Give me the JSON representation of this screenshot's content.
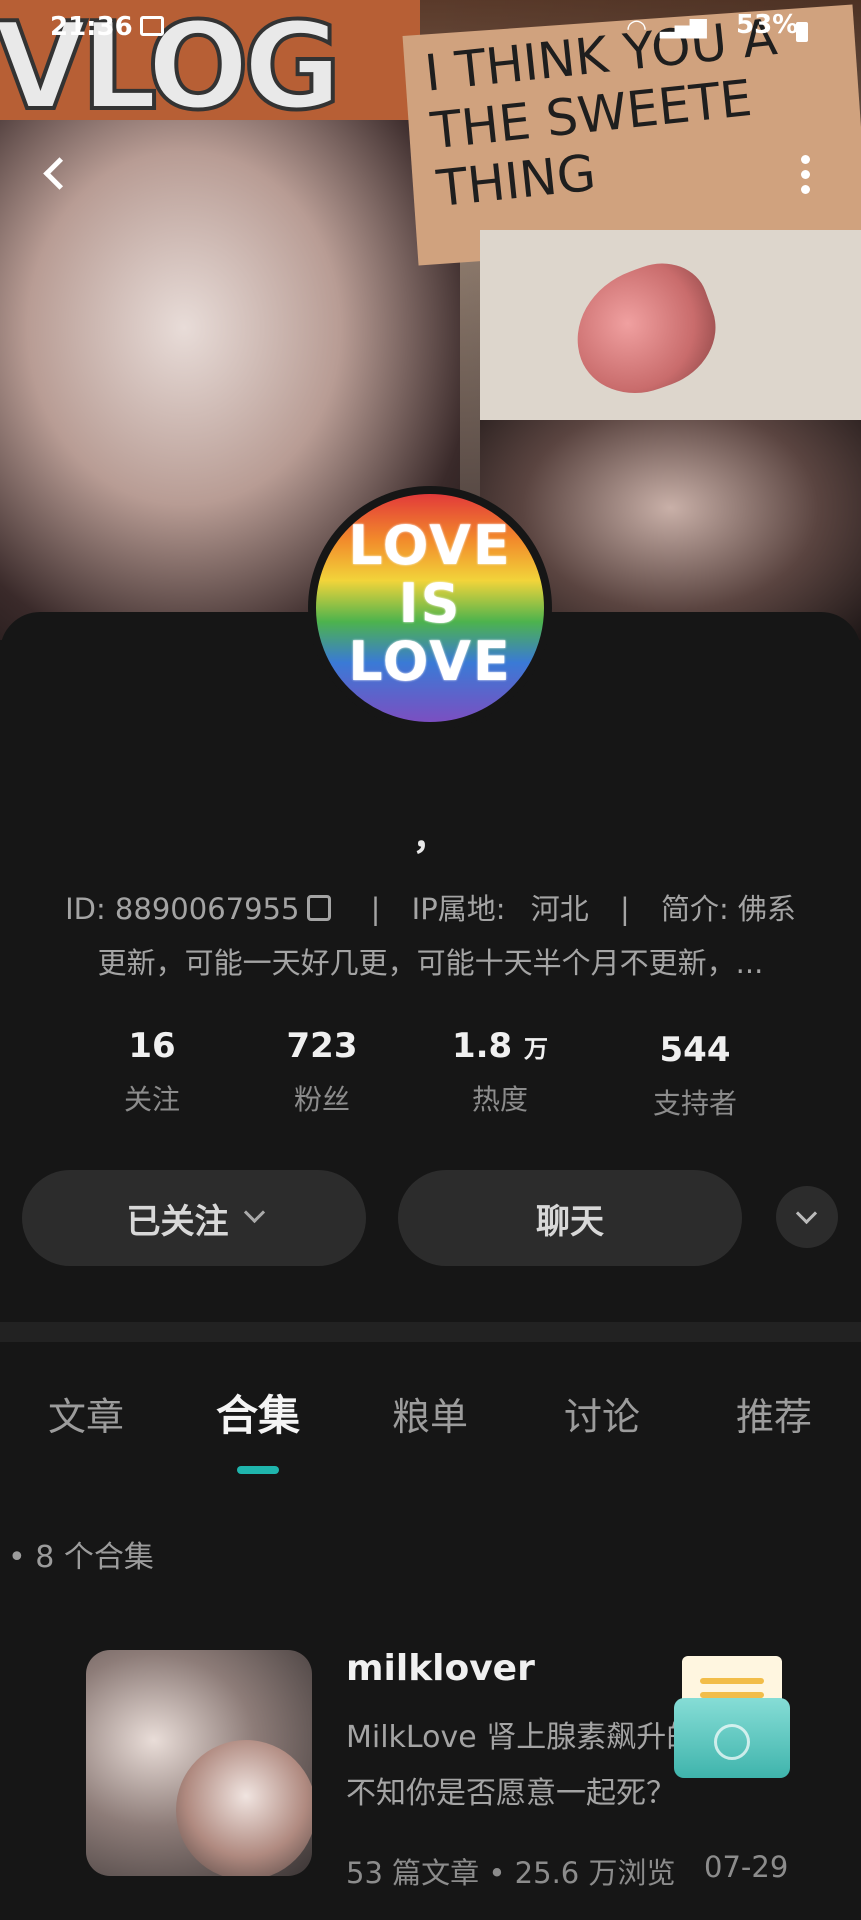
{
  "status_bar": {
    "time": "21:36",
    "battery": "53%"
  },
  "banner": {
    "vlog_text": "VLOG",
    "note_text": "I THINK YOU A THE SWEETE THING"
  },
  "avatar": {
    "line1": "LOVE",
    "line2": "IS",
    "line3": "LOVE"
  },
  "profile": {
    "username": "，",
    "id_label": "ID: 8890067955",
    "ip_label": "IP属地:",
    "ip_value": "河北",
    "intro_label": "简介: 佛系",
    "intro_line2": "更新，可能一天好几更，可能十天半个月不更新，...",
    "separator": "|"
  },
  "stats": [
    {
      "value": "16",
      "unit": "",
      "label": "关注"
    },
    {
      "value": "723",
      "unit": "",
      "label": "粉丝"
    },
    {
      "value": "1.8",
      "unit": "万",
      "label": "热度"
    },
    {
      "value": "544",
      "unit": "",
      "label": "支持者"
    }
  ],
  "actions": {
    "follow": "已关注",
    "chat": "聊天"
  },
  "tabs": [
    "文章",
    "合集",
    "粮单",
    "讨论",
    "推荐"
  ],
  "active_tab": "合集",
  "collections": {
    "count_text": "• 8 个合集",
    "items": [
      {
        "title": "milklover",
        "desc_line1": "MilkLove 肾上腺素飙升的",
        "desc_line2": "不知你是否愿意一起死？",
        "meta": "53 篇文章 • 25.6 万浏览",
        "date": "07-29"
      }
    ]
  },
  "colors": {
    "accent": "#1fb5ad",
    "background": "#161616",
    "button_bg": "#2c2c2c"
  }
}
